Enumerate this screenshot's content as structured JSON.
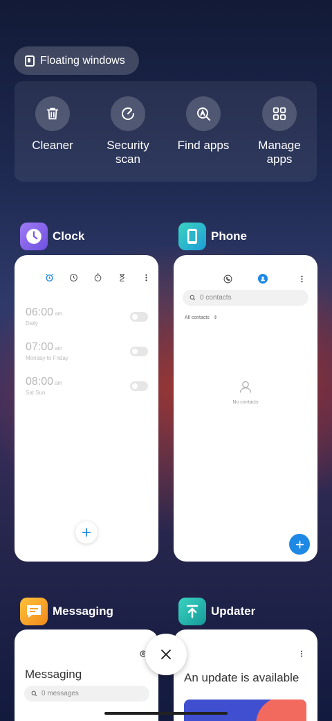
{
  "floating_windows": {
    "label": "Floating windows"
  },
  "tools": [
    {
      "label": "Cleaner",
      "icon": "trash-icon"
    },
    {
      "label": "Security\nscan",
      "icon": "security-scan-icon"
    },
    {
      "label": "Find apps",
      "icon": "find-apps-icon"
    },
    {
      "label": "Manage\napps",
      "icon": "grid-icon"
    }
  ],
  "clock": {
    "name": "Clock",
    "alarms": [
      {
        "time": "06:00",
        "ampm": "am",
        "repeat": "Daily"
      },
      {
        "time": "07:00",
        "ampm": "am",
        "repeat": "Monday to Friday"
      },
      {
        "time": "08:00",
        "ampm": "am",
        "repeat": "Sat Sun"
      }
    ]
  },
  "phone": {
    "name": "Phone",
    "search_placeholder": "0 contacts",
    "filter": "All contacts",
    "empty": "No contacts"
  },
  "messaging": {
    "name": "Messaging",
    "title": "Messaging",
    "search_placeholder": "0 messages"
  },
  "updater": {
    "name": "Updater",
    "title": "An update is available"
  },
  "colors": {
    "accent_blue": "#1e88e5",
    "clock_icon": "#8e6bf0",
    "phone_icon": "#2ec4b6",
    "messaging_icon": "#f5a524",
    "updater_icon": "#26b5a6"
  }
}
